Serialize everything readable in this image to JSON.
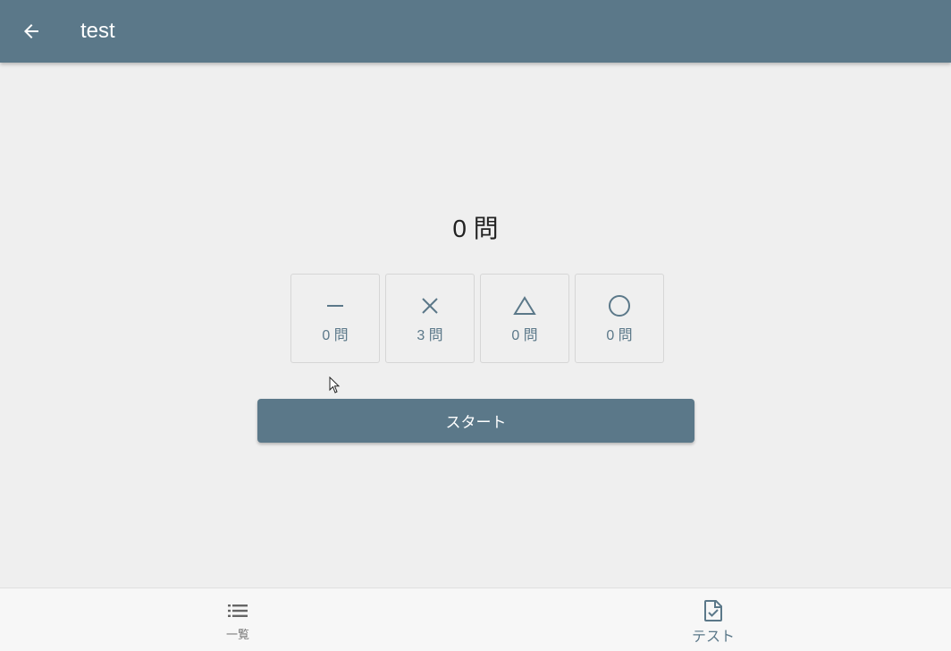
{
  "appbar": {
    "title": "test",
    "back_icon": "arrow-left-icon",
    "color": "#5b7889"
  },
  "main": {
    "total_count": "0 問",
    "cards": [
      {
        "symbol": "dash",
        "icon": "dash-icon",
        "count": "0 問"
      },
      {
        "symbol": "cross",
        "icon": "cross-icon",
        "count": "3 問"
      },
      {
        "symbol": "triangle",
        "icon": "triangle-icon",
        "count": "0 問"
      },
      {
        "symbol": "circle",
        "icon": "circle-icon",
        "count": "0 問"
      }
    ],
    "start_label": "スタート"
  },
  "bottom_nav": {
    "items": [
      {
        "label": "一覧",
        "icon": "list-icon",
        "active": false
      },
      {
        "label": "テスト",
        "icon": "file-check-icon",
        "active": true
      }
    ]
  },
  "colors": {
    "primary": "#5b7889",
    "background": "#efefef"
  }
}
